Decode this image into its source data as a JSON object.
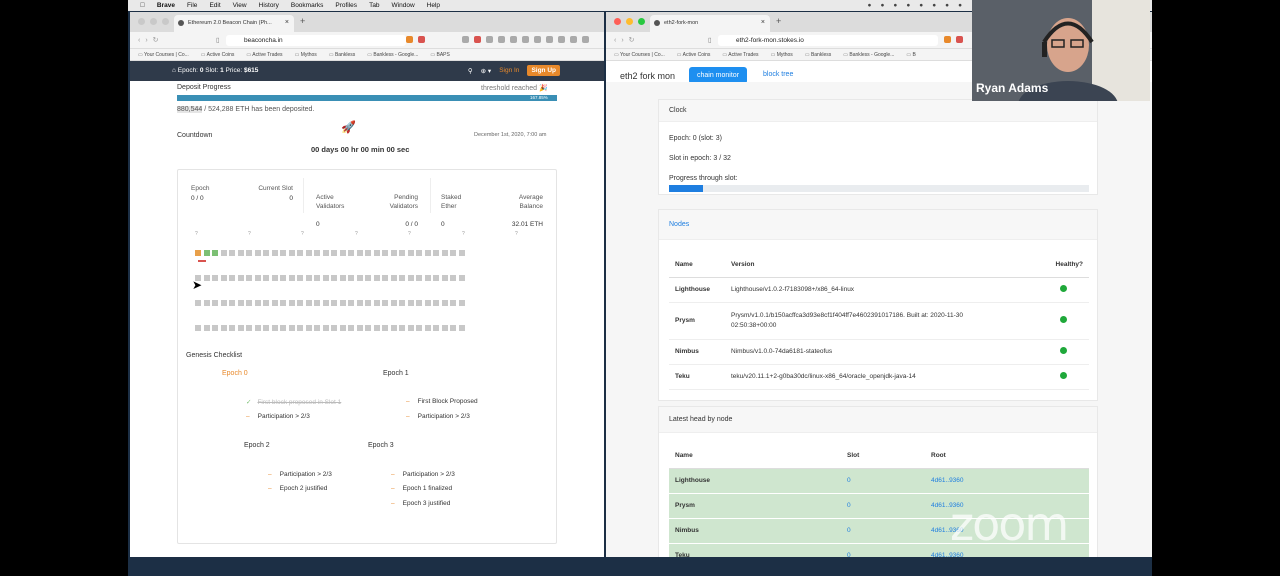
{
  "menubar": {
    "app": "Brave",
    "items": [
      "File",
      "Edit",
      "View",
      "History",
      "Bookmarks",
      "Profiles",
      "Tab",
      "Window",
      "Help"
    ]
  },
  "left_browser": {
    "tab_title": "Ethereum 2.0 Beacon Chain (Ph...",
    "url": "beaconcha.in",
    "bookmarks": [
      "Your Courses | Co...",
      "Active Coins",
      "Active Trades",
      "Mythos",
      "Bankless",
      "Bankless - Google...",
      "BAPS"
    ],
    "header": {
      "epoch_label": "Epoch:",
      "epoch_value": "0",
      "slot_label": "Slot:",
      "slot_value": "1",
      "price_label": "Price:",
      "price_value": "$615",
      "sign_in": "Sign In",
      "sign_up": "Sign Up"
    },
    "deposit": {
      "title": "Deposit Progress",
      "threshold": "threshold reached 🎉",
      "percent_label": "167.85%",
      "fill_percent": 100,
      "deposited": "880,544",
      "summary": " / 524,288 ETH has been deposited."
    },
    "countdown": {
      "title": "Countdown",
      "date": "December 1st, 2020, 7:00 am",
      "value": "00 days 00 hr 00 min 00 sec"
    },
    "stats": [
      {
        "label": "Epoch",
        "value": "0 / 0"
      },
      {
        "label": "Current Slot",
        "value": "0"
      },
      {
        "label": "Active\nValidators",
        "value": "0"
      },
      {
        "label": "Pending\nValidators",
        "value": "0 / 0"
      },
      {
        "label": "Staked\nEther",
        "value": "0"
      },
      {
        "label": "Average\nBalance",
        "value": "32.01 ETH"
      }
    ],
    "genesis": {
      "title": "Genesis Checklist",
      "epoch0": {
        "title": "Epoch 0",
        "items": [
          "First block proposed in Slot 1",
          "Participation > 2/3"
        ]
      },
      "epoch1": {
        "title": "Epoch 1",
        "items": [
          "First Block Proposed",
          "Participation > 2/3"
        ]
      },
      "epoch2": {
        "title": "Epoch 2",
        "items": [
          "Participation > 2/3",
          "Epoch 2 justified"
        ]
      },
      "epoch3": {
        "title": "Epoch 3",
        "items": [
          "Participation > 2/3",
          "Epoch 1 finalized",
          "Epoch 3 justified"
        ]
      }
    }
  },
  "right_browser": {
    "tab_title": "eth2-fork-mon",
    "url": "eth2-fork-mon.stokes.io",
    "bookmarks": [
      "Your Courses | Co...",
      "Active Coins",
      "Active Trades",
      "Mythos",
      "Bankless",
      "Bankless - Google...",
      "B"
    ],
    "brand": "eth2 fork mon",
    "nav_active": "chain monitor",
    "nav_link": "block tree",
    "clock": {
      "title": "Clock",
      "epoch": "Epoch: 0 (slot: 3)",
      "slot_in_epoch": "Slot in epoch: 3 / 32",
      "progress_label": "Progress through slot:",
      "progress_fraction": 0.08
    },
    "nodes": {
      "title": "Nodes",
      "headers": [
        "Name",
        "Version",
        "Healthy?"
      ],
      "rows": [
        {
          "name": "Lighthouse",
          "version": "Lighthouse/v1.0.2-f7183098+/x86_64-linux"
        },
        {
          "name": "Prysm",
          "version": "Prysm/v1.0.1/b150acffca3d93e8cf1f404ff7e4602391017186. Built at: 2020-11-30 02:50:38+00:00"
        },
        {
          "name": "Nimbus",
          "version": "Nimbus/v1.0.0-74da6181-stateofus"
        },
        {
          "name": "Teku",
          "version": "teku/v20.11.1+2-g0ba30dc/linux-x86_64/oracle_openjdk-java-14"
        }
      ]
    },
    "heads": {
      "title": "Latest head by node",
      "headers": [
        "Name",
        "Slot",
        "Root"
      ],
      "rows": [
        {
          "name": "Lighthouse",
          "slot": "0",
          "root": "4d61..9360"
        },
        {
          "name": "Prysm",
          "slot": "0",
          "root": "4d61..9360"
        },
        {
          "name": "Nimbus",
          "slot": "0",
          "root": "4d61..9360"
        },
        {
          "name": "Teku",
          "slot": "0",
          "root": "4d61..9360"
        }
      ]
    }
  },
  "webcam": {
    "name": "Ryan Adams"
  },
  "watermark": "zoom",
  "colors": {
    "accent_blue": "#1e8ff0",
    "beacon_orange": "#e8892b",
    "healthy_green": "#1fa83a",
    "head_row_green": "#cfe6cf"
  }
}
